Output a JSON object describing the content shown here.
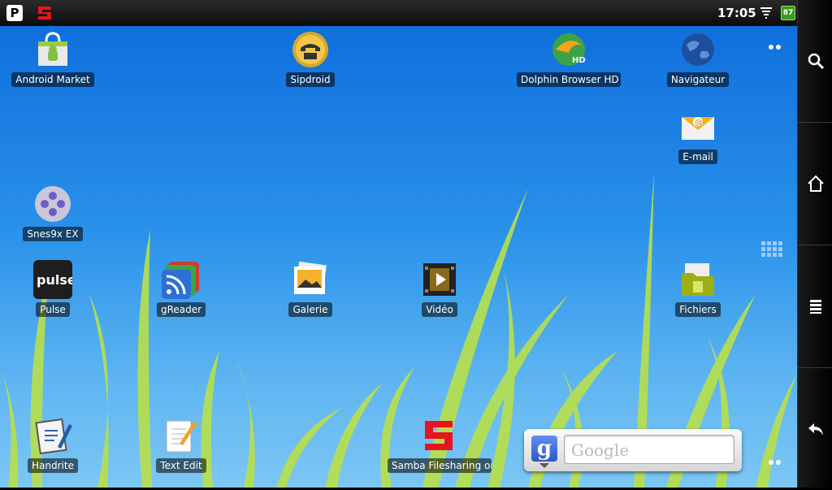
{
  "status": {
    "time": "17:05",
    "battery": "87",
    "notifications": [
      "p-notification-icon",
      "samba-notification-icon"
    ]
  },
  "apps": {
    "market": "Android Market",
    "sipdroid": "Sipdroid",
    "dolphin": "Dolphin Browser HD",
    "navigateur": "Navigateur",
    "email": "E-mail",
    "snes": "Snes9x EX",
    "pulse": "Pulse",
    "greader": "gReader",
    "galerie": "Galerie",
    "video": "Vidéo",
    "fichiers": "Fichiers",
    "handrite": "Handrite",
    "textedit": "Text Edit",
    "samba": "Samba Filesharing on"
  },
  "icon_text": {
    "pulse": "pulse",
    "dolphin_badge": "HD",
    "p_logo": "P"
  },
  "search_widget": {
    "placeholder": "Google",
    "logo": "g"
  },
  "colors": {
    "wallpaper_top": "#0f6fdc",
    "wallpaper_bottom": "#7cc6f4",
    "grass": "#b8e04a",
    "samba_red": "#e8141c"
  }
}
